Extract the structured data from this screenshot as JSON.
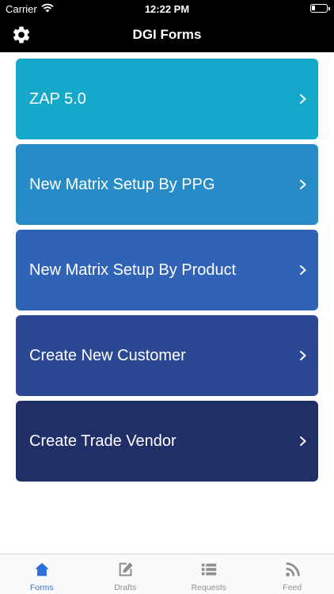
{
  "status_bar": {
    "carrier": "Carrier",
    "time": "12:22 PM"
  },
  "nav": {
    "title": "DGI Forms",
    "settings_icon": "gear-icon"
  },
  "forms": [
    {
      "label": "ZAP 5.0",
      "color": "#14a9ca"
    },
    {
      "label": "New Matrix Setup By PPG",
      "color": "#268bc6"
    },
    {
      "label": "New Matrix Setup By Product",
      "color": "#3063b5"
    },
    {
      "label": "Create New Customer",
      "color": "#2b4895"
    },
    {
      "label": "Create Trade Vendor",
      "color": "#202f68"
    }
  ],
  "tabs": [
    {
      "label": "Forms",
      "icon": "home-icon",
      "active": true
    },
    {
      "label": "Drafts",
      "icon": "edit-icon",
      "active": false
    },
    {
      "label": "Requests",
      "icon": "list-icon",
      "active": false
    },
    {
      "label": "Feed",
      "icon": "rss-icon",
      "active": false
    }
  ],
  "colors": {
    "active_tab": "#2d6fdb",
    "inactive_tab": "#8e8e93",
    "nav_bg": "#000000"
  }
}
